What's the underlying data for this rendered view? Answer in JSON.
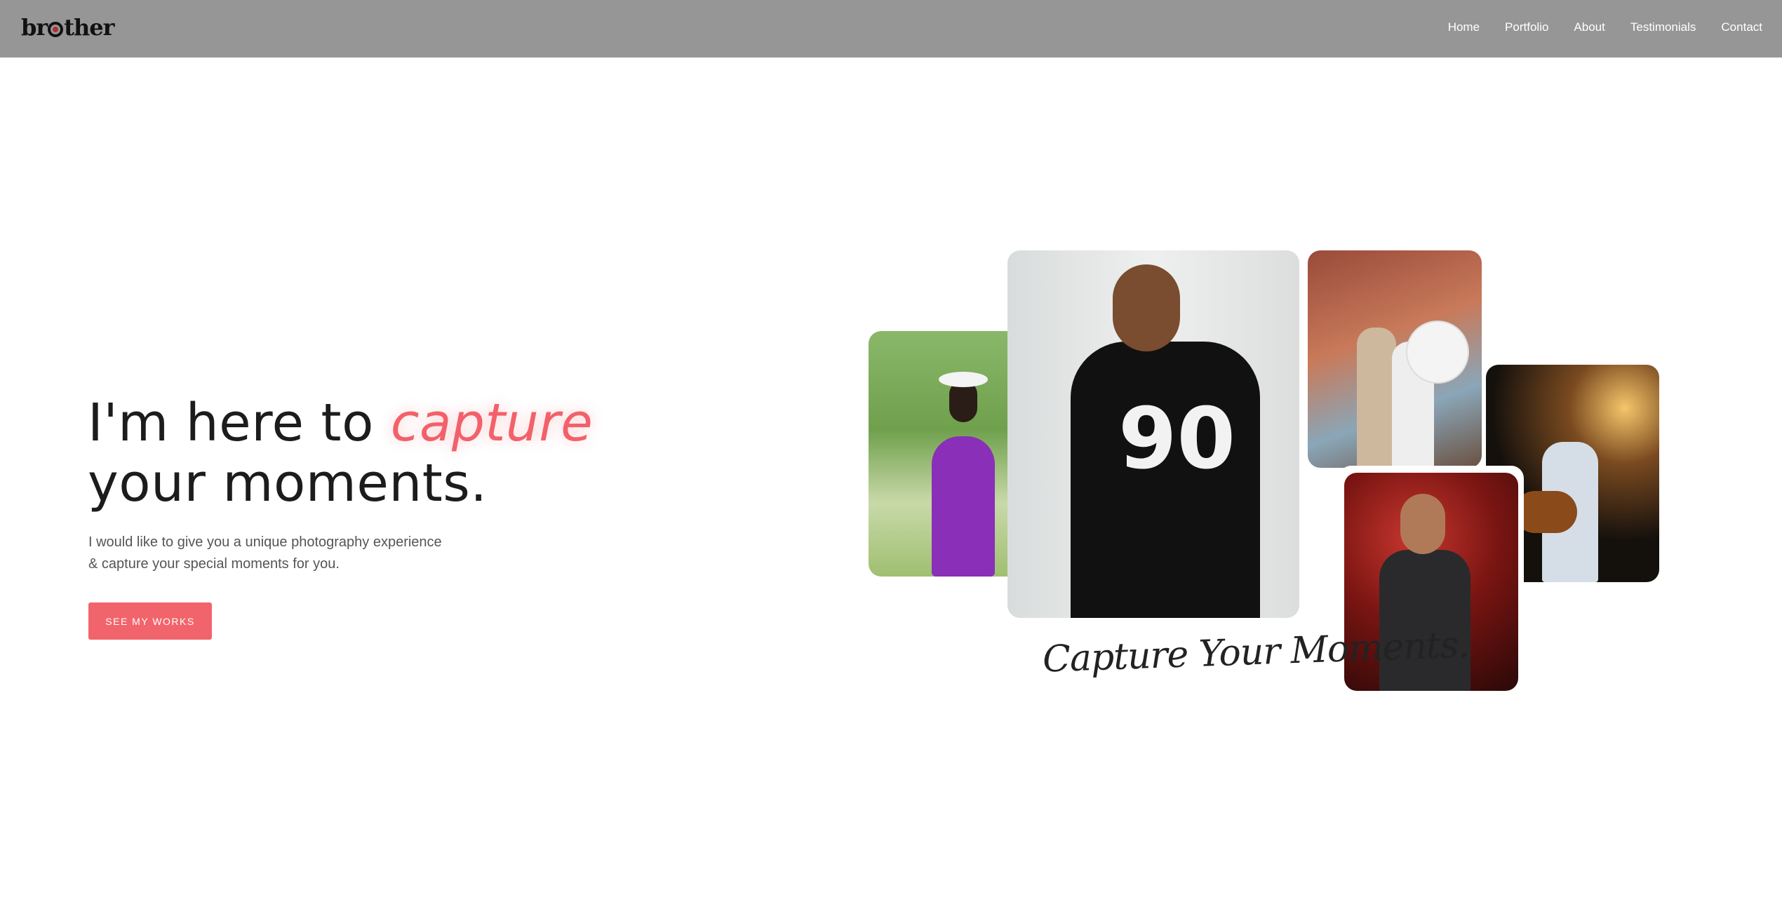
{
  "nav": {
    "logo": "brother",
    "links": [
      "Home",
      "Portfolio",
      "About",
      "Testimonials",
      "Contact"
    ]
  },
  "hero": {
    "title_prefix": "I'm here to",
    "title_accent": "capture",
    "title_line2": "your moments.",
    "subtitle_line1": "I would like to give you a unique photography experience",
    "subtitle_line2": "& capture your special moments for you.",
    "cta_label": "SEE MY WORKS"
  },
  "gallery": {
    "caption": "Capture Your Moments."
  },
  "colors": {
    "accent": "#f2646b",
    "navbar": "#969696"
  }
}
